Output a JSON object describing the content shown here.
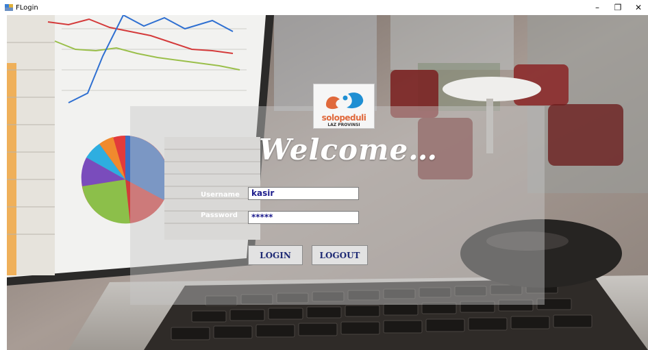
{
  "window": {
    "title": "FLogin",
    "minimize_glyph": "–",
    "restore_glyph": "❐",
    "close_glyph": "✕"
  },
  "logo": {
    "word": "solopeduli",
    "subtitle": "LAZ PROVINSI",
    "colors": {
      "orange": "#e0693c",
      "blue": "#1f8fd3"
    }
  },
  "form": {
    "heading": "Welcome…",
    "username_label": "Username",
    "username_value": "kasir",
    "password_label": "Password",
    "password_value": "*****"
  },
  "buttons": {
    "login": "LOGIN",
    "logout": "LOGOUT"
  },
  "icons": {
    "app": "app-icon",
    "minimize": "minimize-icon",
    "restore": "restore-icon",
    "close": "close-icon"
  }
}
